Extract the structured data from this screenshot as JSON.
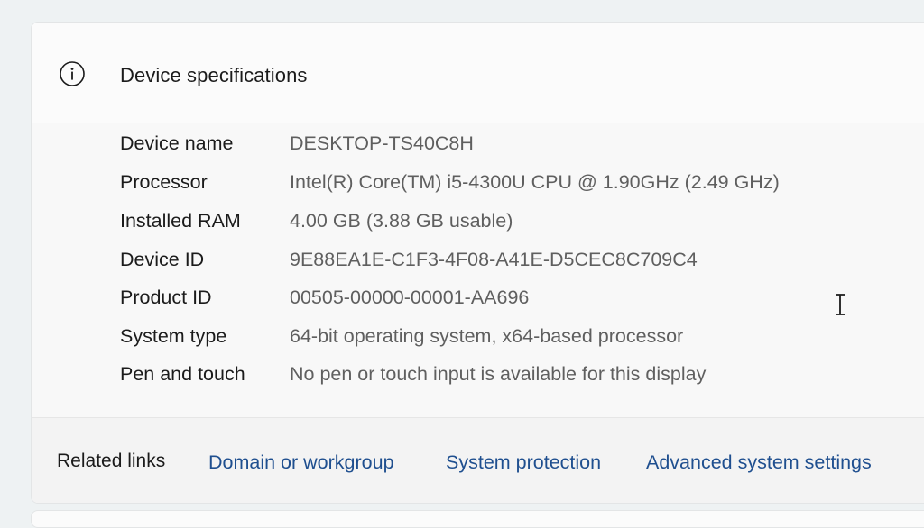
{
  "header": {
    "icon": "info-icon",
    "title": "Device specifications"
  },
  "specs": [
    {
      "label": "Device name",
      "value": "DESKTOP-TS40C8H"
    },
    {
      "label": "Processor",
      "value": "Intel(R) Core(TM) i5-4300U CPU @ 1.90GHz (2.49 GHz)"
    },
    {
      "label": "Installed RAM",
      "value": "4.00 GB (3.88 GB usable)"
    },
    {
      "label": "Device ID",
      "value": "9E88EA1E-C1F3-4F08-A41E-D5CEC8C709C4"
    },
    {
      "label": "Product ID",
      "value": "00505-00000-00001-AA696"
    },
    {
      "label": "System type",
      "value": "64-bit operating system, x64-based processor"
    },
    {
      "label": "Pen and touch",
      "value": "No pen or touch input is available for this display"
    }
  ],
  "related": {
    "title": "Related links",
    "links": [
      "Domain or workgroup",
      "System protection",
      "Advanced system settings"
    ]
  },
  "colors": {
    "link": "#1f4f8f",
    "label": "#1b1b1b",
    "value": "#5f5f5f"
  },
  "cursor_icon": "text-cursor-icon"
}
